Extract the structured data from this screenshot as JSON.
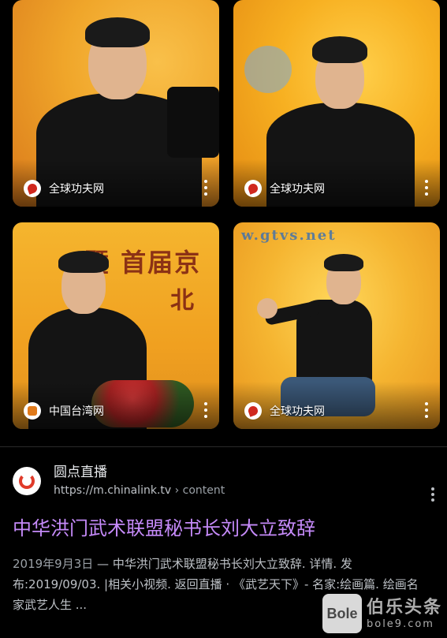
{
  "images": [
    {
      "source": "全球功夫网",
      "icon": "quanqiu-gongfu-logo-icon"
    },
    {
      "source": "全球功夫网",
      "icon": "quanqiu-gongfu-logo-icon"
    },
    {
      "source": "中国台湾网",
      "icon": "taiwan-net-logo-icon",
      "banner_lines": [
        "暨 首届京",
        "北"
      ]
    },
    {
      "source": "全球功夫网",
      "icon": "quanqiu-gongfu-logo-icon",
      "banner_lines": [
        "w.gtvs.net"
      ]
    }
  ],
  "result": {
    "site_name": "圆点直播",
    "url": "https://m.chinalink.tv",
    "url_path": " › content",
    "title": "中华洪门武术联盟秘书长刘大立致辞",
    "date": "2019年9月3日",
    "dash": " — ",
    "snippet": "中华洪门武术联盟秘书长刘大立致辞. 详情. 发布:2019/09/03. |相关小视频. 返回直播 · 《武艺天下》- 名家:绘画篇. 绘画名家武艺人生 ..."
  },
  "watermark": {
    "badge": "Bole",
    "text": "伯乐头条",
    "url": "bole9.com"
  },
  "colors": {
    "link": "#c58af9",
    "background": "#000000",
    "banner_orange": "#f7b021"
  }
}
